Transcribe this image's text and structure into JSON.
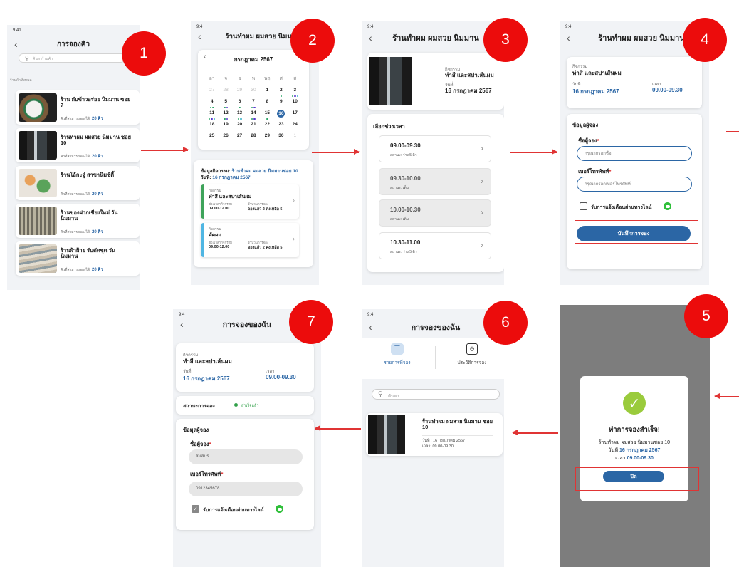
{
  "badges": [
    "1",
    "2",
    "3",
    "4",
    "5",
    "6",
    "7"
  ],
  "status_time": "9:41",
  "status_time_short": "9:4",
  "screen1": {
    "title": "การจองคิว",
    "search_placeholder": "ค้นหาร้านค้า",
    "section": "ร้านค้าทั้งหมด",
    "queue_label": "คิวที่สามารถจองได้",
    "shops": [
      {
        "name": "ร้าน กับข้าวอร่อย นิมมาน ซอย 7",
        "count": "20 คิว"
      },
      {
        "name": "ร้านทำผม ผมสวย นิมมาน ซอย 10",
        "count": "20 คิว"
      },
      {
        "name": "ร้านโอ้กะจู๋ สาขานิมซิตี้",
        "count": "20 คิว"
      },
      {
        "name": "ร้านของฝากเชียงใหม่ วันนิมมาน",
        "count": "20 คิว"
      },
      {
        "name": "ร้านผ้าฝ้าย รับตัดชุด วันนิมมาน",
        "count": "20 คิว"
      }
    ]
  },
  "screen2": {
    "title": "ร้านทำผม ผมสวย นิมมาน",
    "month": "กรกฎาคม 2567",
    "weekdays": [
      "อา",
      "จ",
      "อ",
      "พ",
      "พฤ",
      "ศ",
      "ส"
    ],
    "days": [
      "27",
      "28",
      "29",
      "30",
      "1",
      "2",
      "3",
      "4",
      "5",
      "6",
      "7",
      "8",
      "9",
      "10",
      "11",
      "12",
      "13",
      "14",
      "15",
      "16",
      "17",
      "18",
      "19",
      "20",
      "21",
      "22",
      "23",
      "24",
      "25",
      "26",
      "27",
      "28",
      "29",
      "30",
      "1"
    ],
    "info_label": "ข้อมูลกิจกรรม:",
    "info_shop": "ร้านทำผม ผมสวย นิมมานซอย 10",
    "date_label": "วันที่:",
    "date_value": "16 กรกฎาคม 2567",
    "activities": [
      {
        "cat": "กิจกรรม",
        "name": "ทำสี และสปาเส้นผม",
        "time_label": "ช่วงเวลากิจกรรม",
        "time": "09.00-12.00",
        "status_label": "จำนวนการจอง",
        "status": "จองแล้ว 2 คงเหลือ 5"
      },
      {
        "cat": "กิจกรรม",
        "name": "ตัดผม",
        "time_label": "ช่วงเวลากิจกรรม",
        "time": "09.00-12.00",
        "status_label": "จำนวนการจอง",
        "status": "จองแล้ว 2 คงเหลือ 5"
      }
    ]
  },
  "screen3": {
    "title": "ร้านทำผม ผมสวย นิมมาน",
    "cat_label": "กิจกรรม",
    "activity": "ทำสี และสปาเส้นผม",
    "day_label": "วันที่",
    "date": "16 กรกฎาคม 2567",
    "pick_label": "เลือกช่วงเวลา",
    "slots": [
      {
        "time": "09.00-09.30",
        "status": "สถานะ: ว่าง 5 คิว",
        "available": true
      },
      {
        "time": "09.30-10.00",
        "status": "สถานะ: เต็ม",
        "available": false
      },
      {
        "time": "10.00-10.30",
        "status": "สถานะ: เต็ม",
        "available": false
      },
      {
        "time": "10.30-11.00",
        "status": "สถานะ: ว่าง 5 คิว",
        "available": true
      }
    ]
  },
  "screen4": {
    "title": "ร้านทำผม ผมสวย นิมมาน",
    "cat_label": "กิจกรรม",
    "activity": "ทำสี และสปาเส้นผม",
    "day_label": "วันที่",
    "date": "16 กรกฎาคม 2567",
    "time_label": "เวลา",
    "time": "09.00-09.30",
    "booker_section": "ข้อมูลผู้จอง",
    "name_label": "ชื่อผู้จอง",
    "name_placeholder": "กรุณากรอกชื่อ",
    "phone_label": "เบอร์โทรศัพท์",
    "phone_placeholder": "กรุณากรอกเบอร์โทรศัพท์",
    "required": "*",
    "notify_label": "รับการแจ้งเตือนผ่านทางไลน์",
    "save_label": "บันทึกการจอง"
  },
  "screen5": {
    "success_title": "ทำการจองสำเร็จ!",
    "shop": "ร้านทำผม ผมสวย นิมมานซอย 10",
    "date_label": "วันที่",
    "date": "16 กรกฎาคม 2567",
    "time_label": "เวลา",
    "time": "09.00-09.30",
    "close_label": "ปิด"
  },
  "screen6": {
    "title": "การจองของฉัน",
    "tab_list": "รายการที่จอง",
    "tab_history": "ประวัติการจอง",
    "search_placeholder": "ค้นหา...",
    "item_name": "ร้านทำผม ผมสวย นิมมาน ซอย 10",
    "item_date": "วันที่ : 16 กรกฎาคม 2567",
    "item_time": "เวลา: 09.00-09.30"
  },
  "screen7": {
    "title": "การจองของฉัน",
    "cat_label": "กิจกรรม",
    "activity": "ทำสี และสปาเส้นผม",
    "day_label": "วันที่",
    "date": "16 กรกฎาคม 2567",
    "time_label": "เวลา",
    "time": "09.00-09.30",
    "status_label": "สถานะการจอง :",
    "status_value": "สำเร็จแล้ว",
    "booker_section": "ข้อมูลผู้จอง",
    "name_label": "ชื่อผู้จอง",
    "name_value": "สมสบร",
    "phone_label": "เบอร์โทรศัพท์",
    "phone_value": "0912345678",
    "required": "*",
    "notify_label": "รับการแจ้งเตือนผ่านทางไลน์"
  }
}
